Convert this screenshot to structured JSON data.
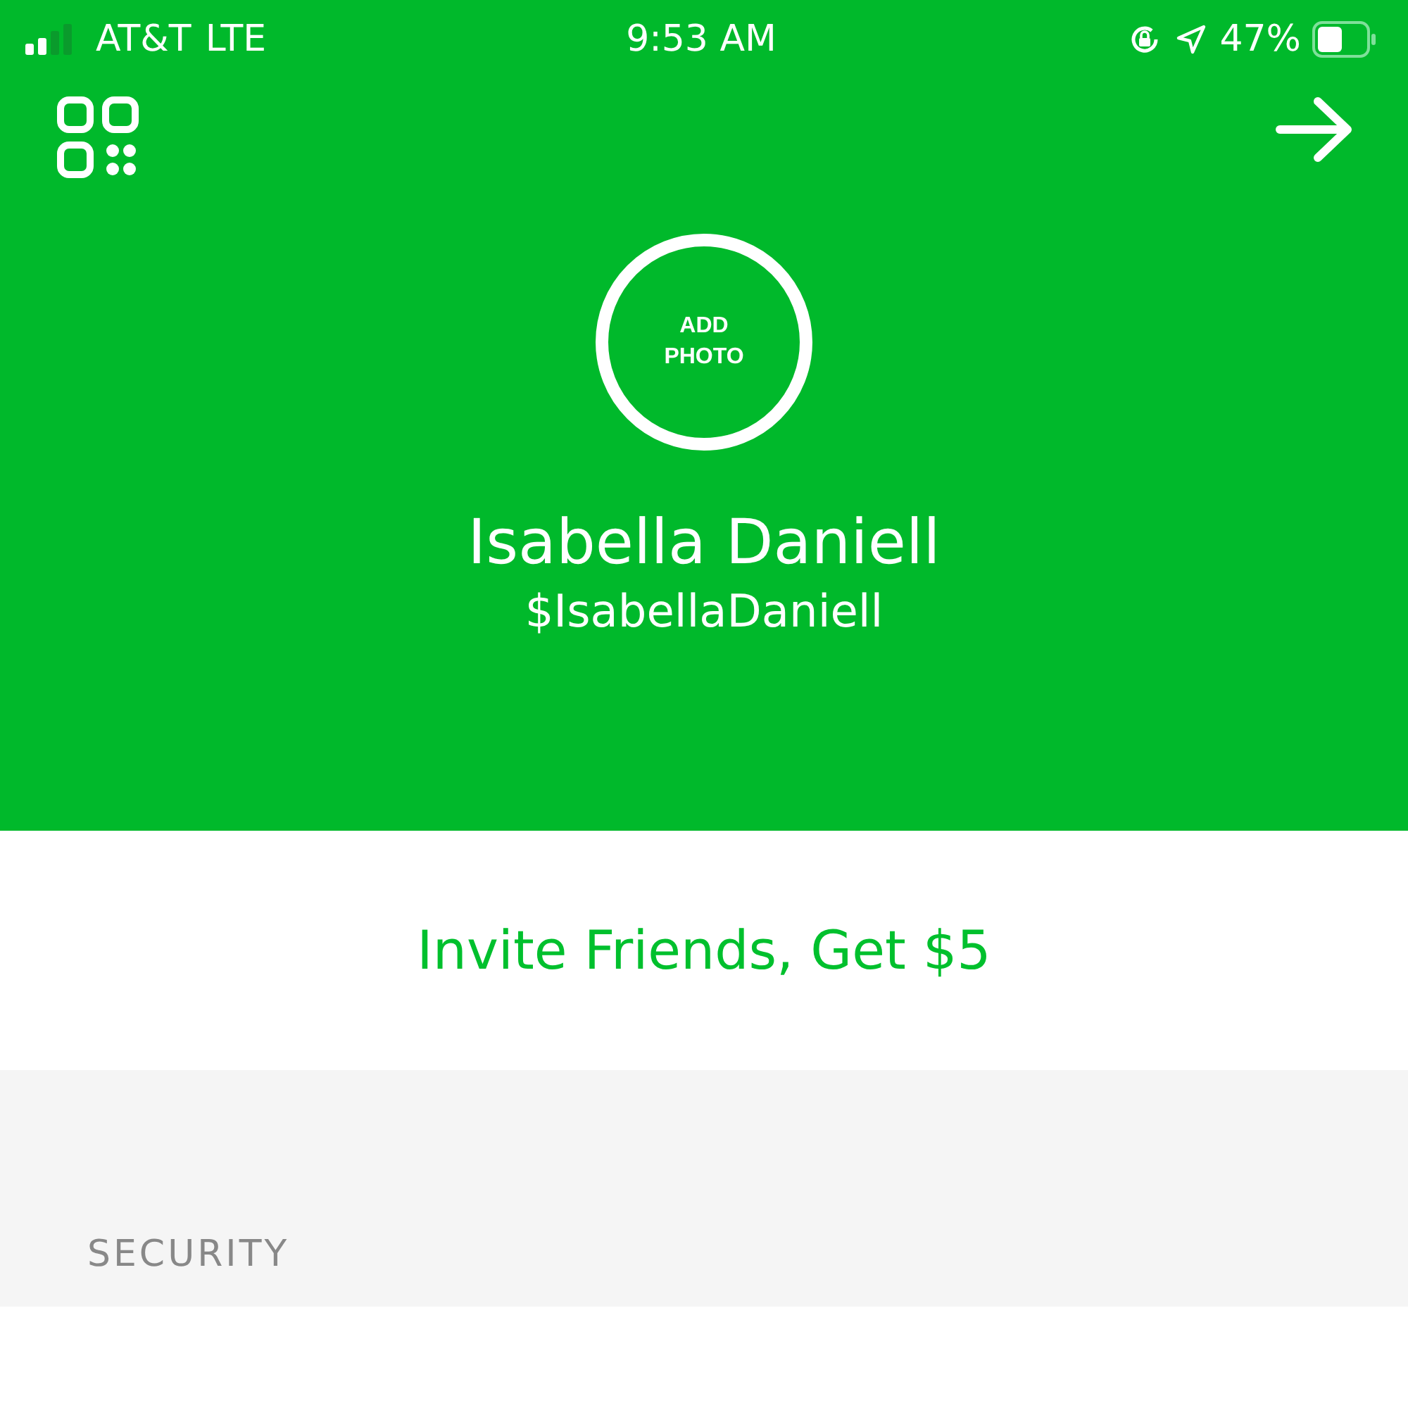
{
  "status_bar": {
    "carrier": "AT&T",
    "network": "LTE",
    "time": "9:53 AM",
    "battery": "47%"
  },
  "profile": {
    "photo_button": "ADD PHOTO",
    "name": "Isabella Daniell",
    "cashtag": "$IsabellaDaniell"
  },
  "invite_link": "Invite Friends, Get $5",
  "section_header": "SECURITY"
}
